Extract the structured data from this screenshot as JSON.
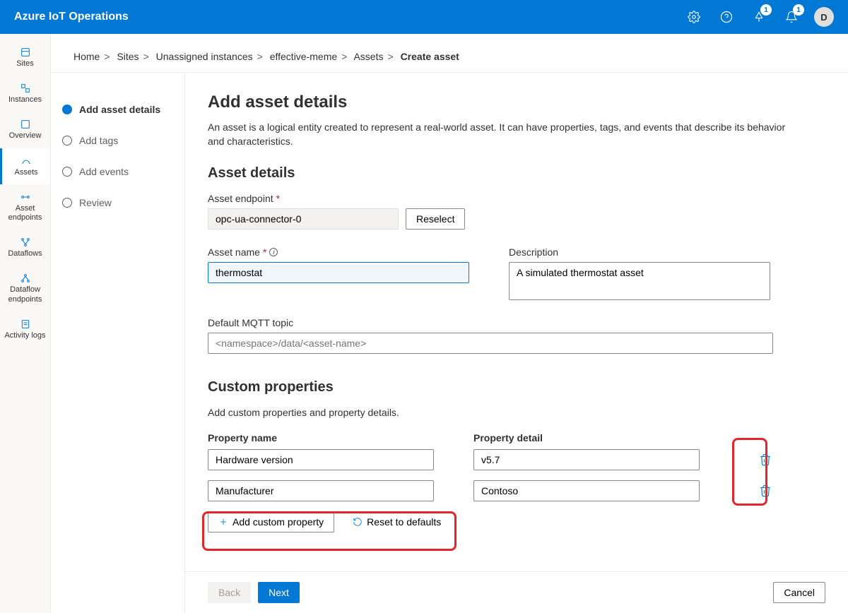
{
  "header": {
    "title": "Azure IoT Operations",
    "badge1": "1",
    "badge2": "1",
    "user_initial": "D"
  },
  "sidenav": {
    "items": [
      {
        "label": "Sites"
      },
      {
        "label": "Instances"
      },
      {
        "label": "Overview"
      },
      {
        "label": "Assets"
      },
      {
        "label": "Asset endpoints"
      },
      {
        "label": "Dataflows"
      },
      {
        "label": "Dataflow endpoints"
      },
      {
        "label": "Activity logs"
      }
    ]
  },
  "breadcrumb": {
    "home": "Home",
    "sites": "Sites",
    "unassigned": "Unassigned instances",
    "instance": "effective-meme",
    "assets": "Assets",
    "current": "Create asset"
  },
  "steps": {
    "0": {
      "label": "Add asset details"
    },
    "1": {
      "label": "Add tags"
    },
    "2": {
      "label": "Add events"
    },
    "3": {
      "label": "Review"
    }
  },
  "form": {
    "title": "Add asset details",
    "intro": "An asset is a logical entity created to represent a real-world asset. It can have properties, tags, and events that describe its behavior and characteristics.",
    "asset_details_heading": "Asset details",
    "endpoint_label": "Asset endpoint",
    "endpoint_value": "opc-ua-connector-0",
    "reselect": "Reselect",
    "asset_name_label": "Asset name",
    "asset_name_value": "thermostat",
    "description_label": "Description",
    "description_value": "A simulated thermostat asset",
    "mqtt_label": "Default MQTT topic",
    "mqtt_placeholder": "<namespace>/data/<asset-name>",
    "custom_props_heading": "Custom properties",
    "custom_props_desc": "Add custom properties and property details.",
    "prop_name_header": "Property name",
    "prop_detail_header": "Property detail",
    "rows": [
      {
        "name": "Hardware version",
        "detail": "v5.7"
      },
      {
        "name": "Manufacturer",
        "detail": "Contoso"
      }
    ],
    "add_custom": "Add custom property",
    "reset_defaults": "Reset to defaults"
  },
  "footer": {
    "back": "Back",
    "next": "Next",
    "cancel": "Cancel"
  }
}
